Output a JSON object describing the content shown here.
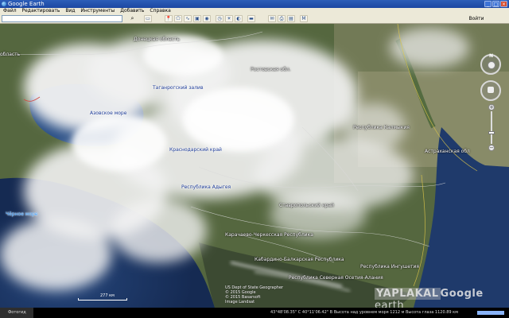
{
  "window": {
    "title": "Google Earth",
    "controls": [
      "_",
      "□",
      "×"
    ]
  },
  "menu": {
    "items": [
      "Файл",
      "Редактировать",
      "Вид",
      "Инструменты",
      "Добавить",
      "Справка"
    ]
  },
  "toolbar": {
    "search_value": "",
    "search_icon": "search-icon",
    "tools": [
      "hide-sidebar-icon",
      "placemark-icon",
      "polygon-icon",
      "path-icon",
      "overlay-icon",
      "tour-icon",
      "history-icon",
      "sun-icon",
      "planets-icon",
      "ruler-icon",
      "email-icon",
      "print-icon",
      "save-image-icon",
      "maps-icon"
    ],
    "signin_label": "Войти"
  },
  "map": {
    "labels": {
      "oblast_left": "область",
      "donetsk": "Донецкая область",
      "rostov": "Ростовская обл.",
      "taganrog": "Таганрогский залив",
      "azov": "Азовское море",
      "kalmykia": "Республика Калмыкия",
      "krasnodar": "Краснодарский край",
      "astrakhan": "Астраханская обл",
      "adygea": "Республика Адыгея",
      "black_sea": "Чёрное море",
      "stavropol": "Ставропольский край",
      "kchr": "Карачаево-Черкесская Республика",
      "kbr": "Кабардино-Балкарская Республика",
      "ingushetia": "Республика Ингушетия",
      "north_ossetia": "Республика Северная Осетия-Алания"
    },
    "scale_label": "277 км",
    "attribution": [
      "US Dept of State Geographer",
      "© 2015 Google",
      "© 2015 Basarsoft",
      "Image Landsat"
    ],
    "watermark": {
      "brand": "YAPLAKAL",
      "suffix": "Google",
      "earth": "earth"
    }
  },
  "navigation": {
    "north_label": "N",
    "zoom_in": "+",
    "zoom_out": "−",
    "zoom_level": 0.6
  },
  "status": {
    "taskbar_item": "Фотогид",
    "coords": "43°48'08.35\" С  40°11'06.42\" В  Высота над уровнем моря  1212 м   Высота глаза 1120.89 км",
    "stream_progress": 1.0
  },
  "colors": {
    "titlebar": "#1b47a2",
    "chrome": "#ece9d8",
    "sea": "#1f3a6b",
    "land": "#4f6340"
  }
}
